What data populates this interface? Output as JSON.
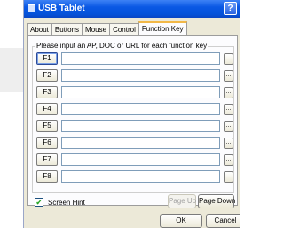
{
  "window": {
    "title": "USB Tablet",
    "help_label": "?"
  },
  "tabs": [
    {
      "label": "About"
    },
    {
      "label": "Buttons"
    },
    {
      "label": "Mouse"
    },
    {
      "label": "Control"
    },
    {
      "label": "Function Key",
      "active": true
    }
  ],
  "group": {
    "legend": "Please input an AP, DOC or URL for each function key"
  },
  "function_keys": [
    {
      "label": "F1",
      "value": "",
      "browse_label": "..."
    },
    {
      "label": "F2",
      "value": "",
      "browse_label": "..."
    },
    {
      "label": "F3",
      "value": "",
      "browse_label": "..."
    },
    {
      "label": "F4",
      "value": "",
      "browse_label": "..."
    },
    {
      "label": "F5",
      "value": "",
      "browse_label": "..."
    },
    {
      "label": "F6",
      "value": "",
      "browse_label": "..."
    },
    {
      "label": "F7",
      "value": "",
      "browse_label": "..."
    },
    {
      "label": "F8",
      "value": "",
      "browse_label": "..."
    }
  ],
  "screen_hint": {
    "label": "Screen Hint",
    "checked": true,
    "check_mark": "✔"
  },
  "paging": {
    "page_up_label": "Page Up",
    "page_up_enabled": false,
    "page_down_label": "Page Down",
    "page_down_enabled": true
  },
  "dialog_buttons": {
    "ok_label": "OK",
    "cancel_label": "Cancel"
  },
  "colors": {
    "titlebar": "#0a58e4",
    "active_tab_accent": "#f2b847",
    "dialog_face": "#ece9d8"
  }
}
